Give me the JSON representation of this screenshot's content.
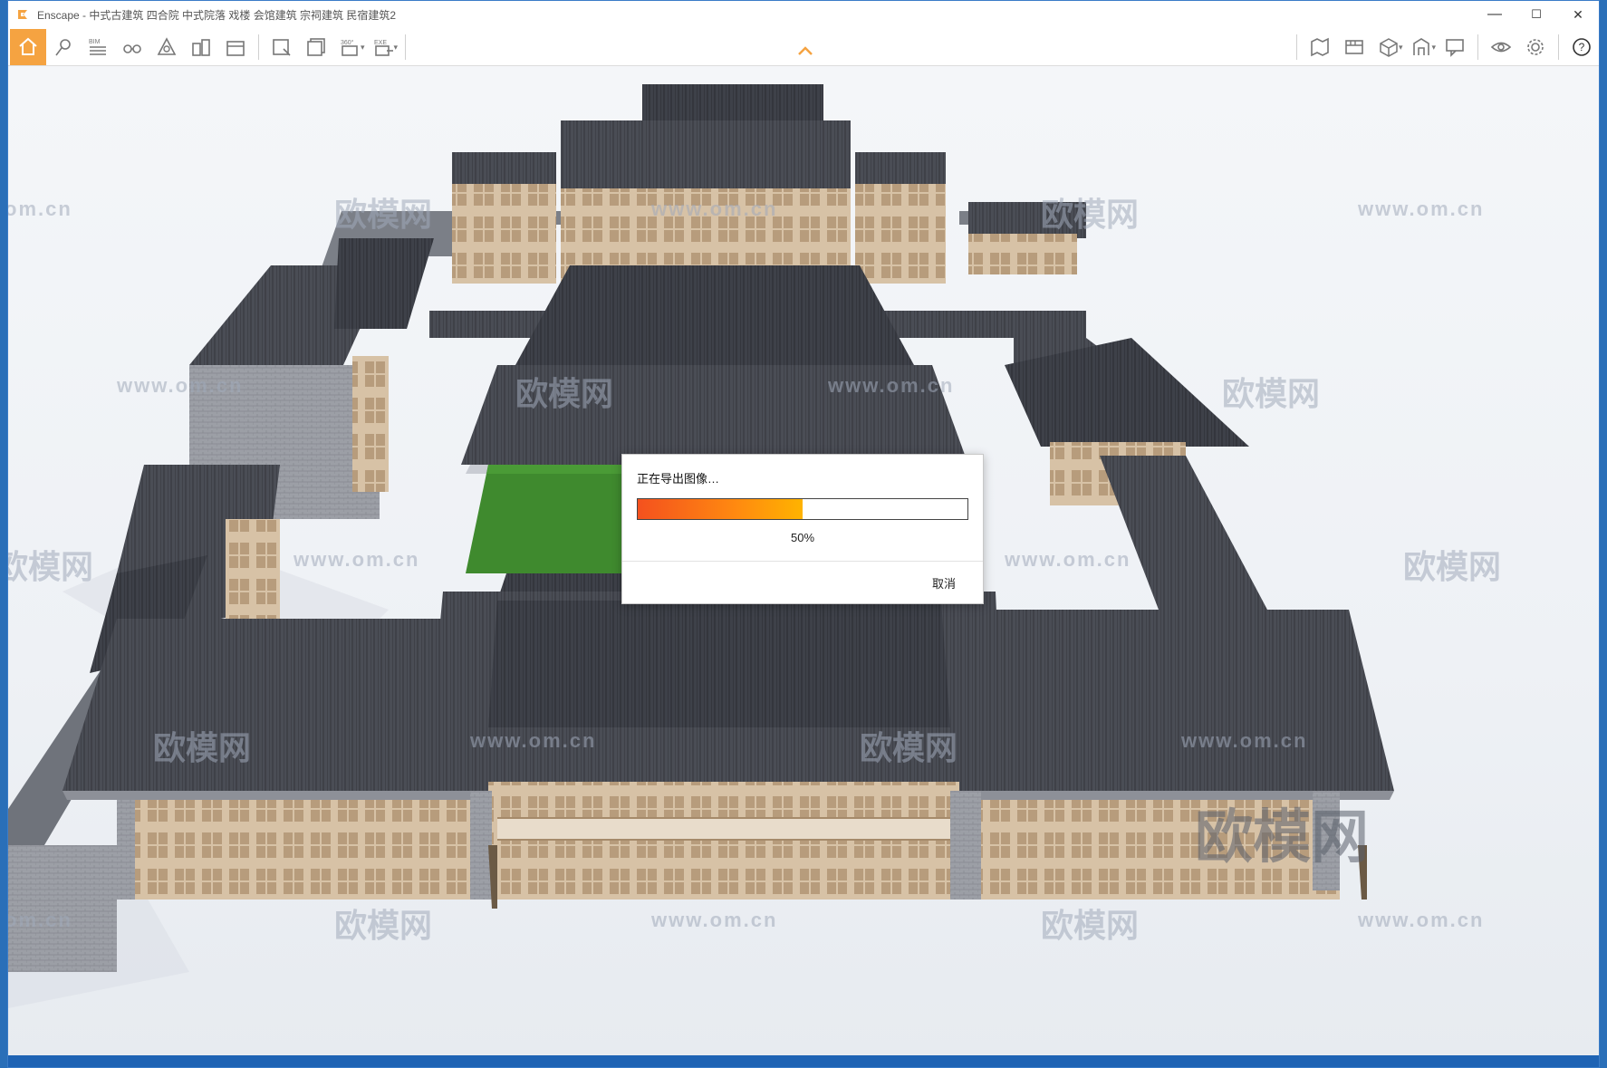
{
  "window": {
    "title": "Enscape - 中式古建筑 四合院 中式院落 戏楼 会馆建筑 宗祠建筑 民宿建筑2",
    "controls": {
      "minimize": "—",
      "maximize": "☐",
      "close": "✕"
    }
  },
  "toolbar": {
    "left_tools": [
      {
        "icon": "home-icon"
      },
      {
        "icon": "map-pin-icon"
      },
      {
        "icon": "bim-icon",
        "label": "BIM"
      },
      {
        "icon": "binoculars-icon"
      },
      {
        "icon": "material-icon"
      },
      {
        "icon": "buildings-icon"
      },
      {
        "icon": "asset-library-icon"
      },
      {
        "icon": "screenshot-icon"
      },
      {
        "icon": "batch-render-icon"
      },
      {
        "icon": "panorama-icon",
        "label": "360°"
      },
      {
        "icon": "exe-export-icon",
        "label": "EXE"
      }
    ],
    "right_tools": [
      {
        "icon": "map-icon"
      },
      {
        "icon": "video-editor-icon"
      },
      {
        "icon": "cube-view-icon"
      },
      {
        "icon": "section-icon"
      },
      {
        "icon": "reviews-icon"
      },
      {
        "icon": "visibility-icon"
      },
      {
        "icon": "settings-gear-icon"
      },
      {
        "icon": "help-icon",
        "label": "?"
      }
    ]
  },
  "dialog": {
    "title": "正在导出图像…",
    "progress_percent": 50,
    "progress_label": "50%",
    "cancel_label": "取消"
  },
  "watermarks": {
    "url": "www.om.cn",
    "url_partial": "om.cn",
    "brand": "欧模网"
  },
  "colors": {
    "accent": "#f5a341",
    "progress_start": "#f4511e",
    "progress_end": "#ffb300",
    "statusbar": "#1e63b4"
  }
}
